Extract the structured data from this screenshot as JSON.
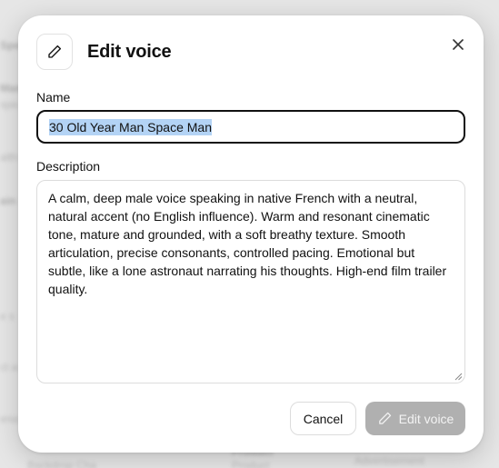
{
  "backdrop": {
    "snippets": [
      "Spe",
      "Man",
      "spa",
      "alth",
      "ain",
      "e s",
      "ct a",
      "ena",
      "Backdrop Cha",
      "Product",
      "Advertisement",
      "Product"
    ]
  },
  "modal": {
    "title": "Edit voice",
    "title_icon": "pencil-icon",
    "close_icon": "close-icon",
    "name_label": "Name",
    "name_value": "30 Old Year Man Space Man",
    "description_label": "Description",
    "description_value": "A calm, deep male voice speaking in native French with a neutral, natural accent (no English influence). Warm and resonant cinematic tone, mature and grounded, with a soft breathy texture. Smooth articulation, precise consonants, controlled pacing. Emotional but subtle, like a lone astronaut narrating his thoughts. High-end film trailer quality.",
    "cancel_label": "Cancel",
    "submit_label": "Edit voice",
    "submit_icon": "pencil-icon"
  },
  "colors": {
    "modal_bg": "#ffffff",
    "text": "#111111",
    "selection": "#b3d3f5",
    "submit_disabled_bg": "#b0b0b0",
    "border": "#dcdcdc"
  }
}
